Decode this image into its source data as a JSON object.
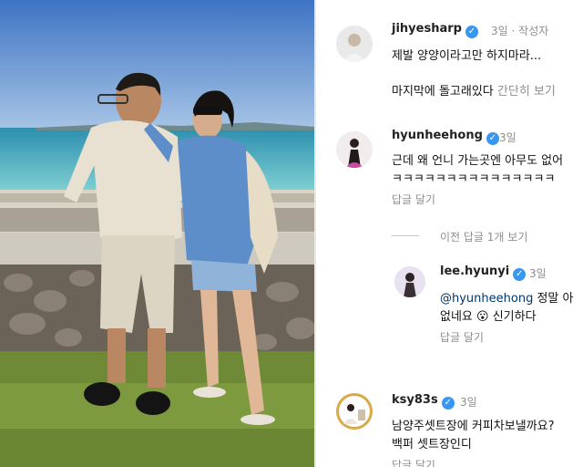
{
  "post_photo": {
    "alt": "photo"
  },
  "comments": [
    {
      "username": "jihyesharp",
      "time": "3일",
      "separator": "·",
      "author_label": "작성자",
      "lines": [
        "제발 양양이라고만 하지마라...",
        "마지막에 돌고래있다"
      ],
      "more_label": "간단히 보기"
    },
    {
      "username": "hyunheehong",
      "time": "3일",
      "lines": [
        "근데 왜 언니 가는곳엔 아무도 없어",
        "ㅋㅋㅋㅋㅋㅋㅋㅋㅋㅋㅋㅋㅋㅋㅋ"
      ],
      "reply_label": "답글 달기",
      "view_previous": "이전 답글 1개 보기"
    },
    {
      "username": "lee.hyunyi",
      "time": "3일",
      "mention": "@hyunheehong",
      "line1_rest": " 정말 아",
      "line2": "없네요",
      "emoji": "😮",
      "line2_rest": " 신기하다",
      "reply_label": "답글 달기"
    },
    {
      "username": "ksy83s",
      "time": "3일",
      "lines": [
        "남양주셋트장에 커피차보낼까요? ",
        "백퍼 셋트장인디"
      ],
      "reply_label": "답글 달기"
    }
  ],
  "icons": {
    "verified": "verified-badge-icon"
  },
  "colors": {
    "verified": "#3897f0",
    "muted": "#8e8e8e",
    "mention": "#00376b"
  }
}
